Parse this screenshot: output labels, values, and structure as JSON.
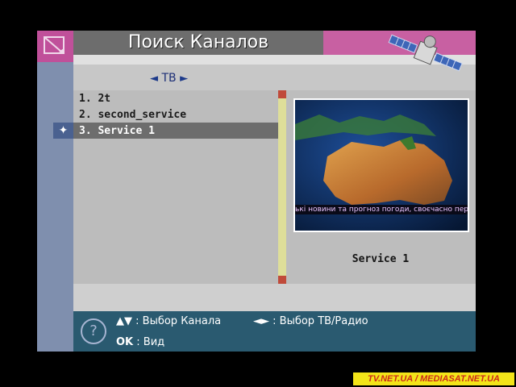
{
  "title": "Поиск Каналов",
  "tv_selector": {
    "left": "◄",
    "label": "ТВ",
    "right": "►"
  },
  "channels": [
    {
      "label": "1. 2t"
    },
    {
      "label": "2. second_service"
    },
    {
      "label": "3. Service 1"
    }
  ],
  "selected_index": 2,
  "preview": {
    "ticker": "ькі новини та прогноз погоди, своєчасно пер",
    "caption": "Service 1"
  },
  "help": {
    "icon": "?",
    "line1_keys": "▲▼",
    "line1_text": ": Выбор Канала",
    "line1b_keys": "◄►",
    "line1b_text": ": Выбор ТВ/Радио",
    "line2_keys": "OK",
    "line2_text": ": Вид"
  },
  "watermark": "TV.NET.UA / MEDIASAT.NET.UA",
  "colors": {
    "accent_pink": "#c860a2",
    "help_bar": "#2a5a70",
    "selection": "#6d6d6d"
  }
}
